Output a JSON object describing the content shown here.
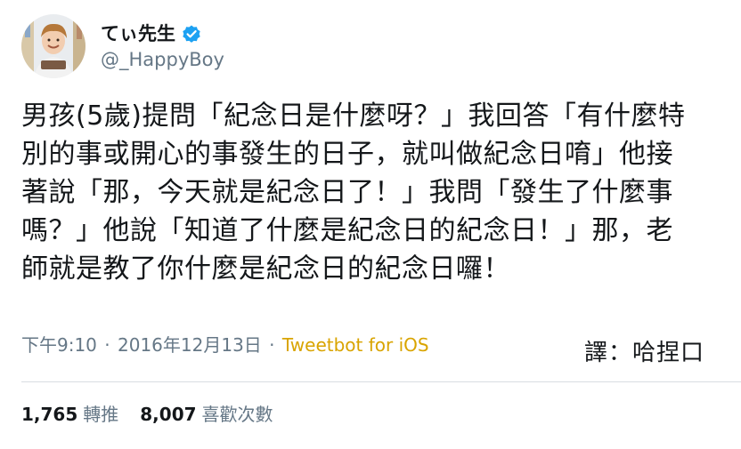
{
  "user": {
    "display_name": "てぃ先生",
    "handle": "@_HappyBoy",
    "verified_icon": "verified-badge-icon",
    "avatar": "profile-photo"
  },
  "tweet": {
    "lines": [
      "男孩(5歲)提問「紀念日是什麼呀？」我回答「有什麼特",
      "別的事或開心的事發生的日子，就叫做紀念日唷」他接",
      "著說「那，今天就是紀念日了！」我問「發生了什麼事",
      "嗎？」他說「知道了什麼是紀念日的紀念日！」那，老",
      "師就是教了你什麼是紀念日的紀念日囉！"
    ]
  },
  "meta": {
    "time": "下午9:10",
    "separator": "·",
    "date": "2016年12月13日",
    "source": "Tweetbot for iOS"
  },
  "translator": "譯：哈捏口",
  "stats": {
    "retweets": {
      "count": "1,765",
      "label": "轉推"
    },
    "likes": {
      "count": "8,007",
      "label": "喜歡次數"
    }
  },
  "colors": {
    "verified": "#1da1f2",
    "source_link": "#d9a400",
    "muted": "#657786",
    "divider": "#d9dde1"
  }
}
